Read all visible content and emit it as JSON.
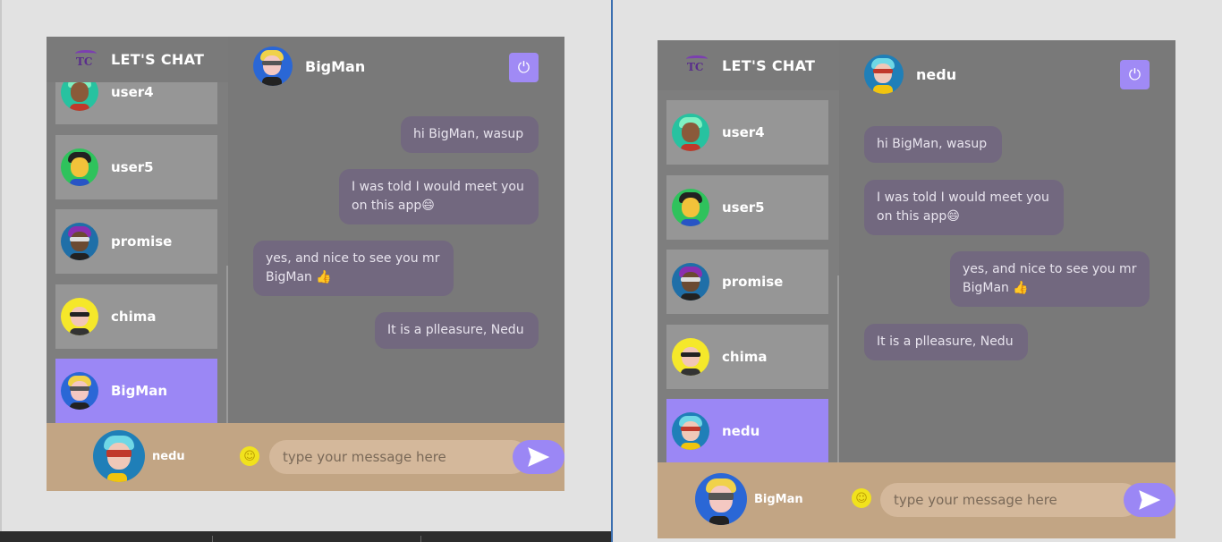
{
  "app_title": "LET'S CHAT",
  "colors": {
    "accent": "#9b87f5",
    "footer": "#c2a584",
    "bubble": "#72687f",
    "panel": "#797979",
    "list_item": "#969696"
  },
  "input_placeholder": "type your message here",
  "icons": {
    "power": "power-icon",
    "send": "send-icon",
    "emoji": "smiley-icon",
    "logo": "tc-logo"
  },
  "left_window": {
    "chat_with": "BigMan",
    "current_user": "nedu",
    "users": [
      {
        "name": "user4",
        "active": false
      },
      {
        "name": "user5",
        "active": false
      },
      {
        "name": "promise",
        "active": false
      },
      {
        "name": "chima",
        "active": false
      },
      {
        "name": "BigMan",
        "active": true
      }
    ],
    "messages": [
      {
        "text": "hi BigMan, wasup",
        "side": "right"
      },
      {
        "text": "I was told I would meet you on this app😄",
        "side": "right"
      },
      {
        "text": "yes, and nice to see you mr BigMan 👍",
        "side": "left"
      },
      {
        "text": "It is a plleasure, Nedu",
        "side": "right"
      }
    ]
  },
  "right_window": {
    "chat_with": "nedu",
    "current_user": "BigMan",
    "users": [
      {
        "name": "user4",
        "active": false
      },
      {
        "name": "user5",
        "active": false
      },
      {
        "name": "promise",
        "active": false
      },
      {
        "name": "chima",
        "active": false
      },
      {
        "name": "nedu",
        "active": true
      }
    ],
    "messages": [
      {
        "text": "hi BigMan, wasup",
        "side": "left"
      },
      {
        "text": "I was told I would meet you on this app😄",
        "side": "left"
      },
      {
        "text": "yes, and nice to see you mr BigMan 👍",
        "side": "right"
      },
      {
        "text": "It is a plleasure, Nedu",
        "side": "left"
      }
    ]
  }
}
